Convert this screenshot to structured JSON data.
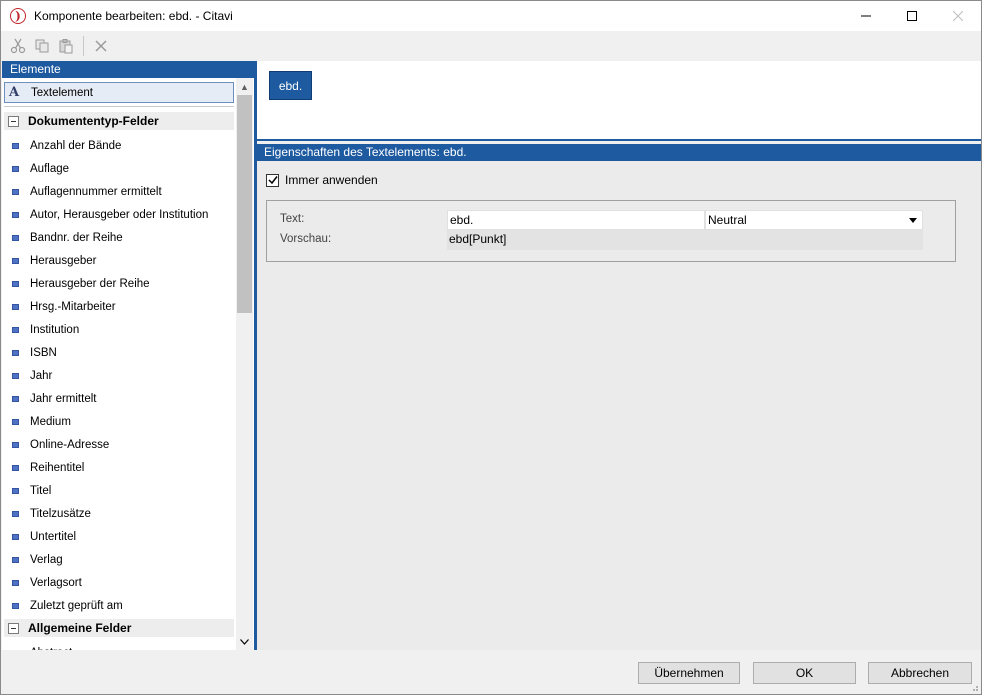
{
  "window": {
    "title": "Komponente bearbeiten: ebd. - Citavi",
    "minimize": "—",
    "maximize": "☐",
    "close": "✕"
  },
  "toolbar": {
    "buttons": [
      "cut-icon",
      "copy-icon",
      "paste-icon",
      "delete-icon"
    ]
  },
  "left": {
    "header": "Elemente",
    "text_element": "Textelement",
    "groups": [
      {
        "label": "Dokumententyp-Felder",
        "items": [
          "Anzahl der Bände",
          "Auflage",
          "Auflagennummer ermittelt",
          "Autor, Herausgeber oder Institution",
          "Bandnr. der Reihe",
          "Herausgeber",
          "Herausgeber der Reihe",
          "Hrsg.-Mitarbeiter",
          "Institution",
          "ISBN",
          "Jahr",
          "Jahr ermittelt",
          "Medium",
          "Online-Adresse",
          "Reihentitel",
          "Titel",
          "Titelzusätze",
          "Untertitel",
          "Verlag",
          "Verlagsort",
          "Zuletzt geprüft am"
        ]
      },
      {
        "label": "Allgemeine Felder",
        "items": [
          "Abstract"
        ]
      }
    ]
  },
  "preview": {
    "chip": "ebd."
  },
  "properties": {
    "header": "Eigenschaften des Textelements:  ebd.",
    "always_apply_label": "Immer anwenden",
    "always_apply_checked": true,
    "text_label": "Text:",
    "text_value": "ebd.",
    "style_value": "Neutral",
    "preview_label": "Vorschau:",
    "preview_value": "ebd[Punkt]"
  },
  "buttons": {
    "apply": "Übernehmen",
    "ok": "OK",
    "cancel": "Abbrechen"
  },
  "colors": {
    "accent": "#1e5aa0",
    "field_icon": "#4f72c4",
    "app_icon": "#c0262d"
  }
}
